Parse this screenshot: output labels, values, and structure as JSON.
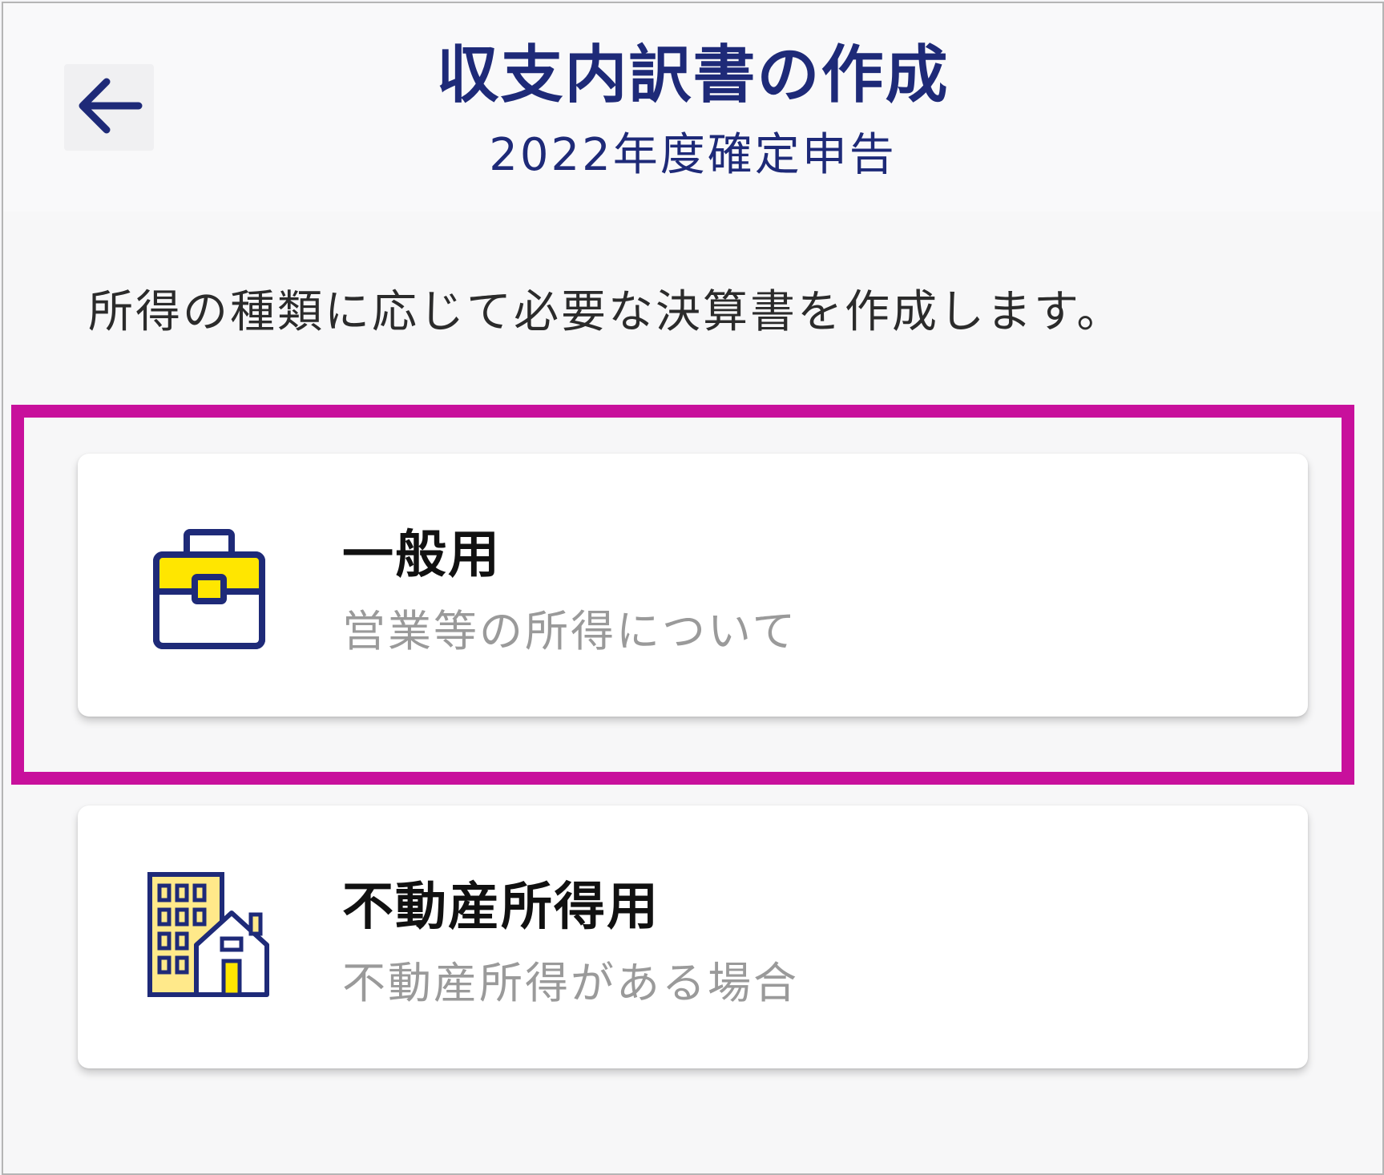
{
  "header": {
    "title": "収支内訳書の作成",
    "subtitle": "2022年度確定申告",
    "back_icon": "arrow-left-icon"
  },
  "description": "所得の種類に応じて必要な決算書を作成します。",
  "options": [
    {
      "title": "一般用",
      "subtitle": "営業等の所得について",
      "icon": "briefcase-icon"
    },
    {
      "title": "不動産所得用",
      "subtitle": "不動産所得がある場合",
      "icon": "building-house-icon"
    }
  ],
  "colors": {
    "navy": "#1e2a78",
    "yellow": "#ffe600",
    "highlight": "#c8109c",
    "muted_text": "#9a9a9a"
  }
}
